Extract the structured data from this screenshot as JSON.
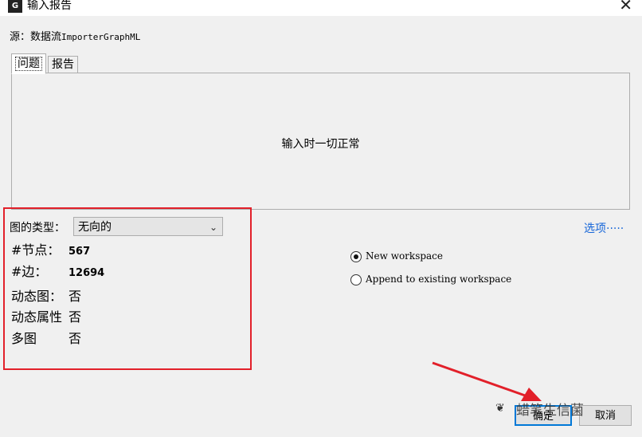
{
  "window": {
    "title": "输入报告",
    "app_icon": "gephi-app-icon",
    "close_label": "✕"
  },
  "source": {
    "label": "源：",
    "value_prefix": "数据流",
    "value_name": "ImporterGraphML"
  },
  "tabs": [
    {
      "label": "问题"
    },
    {
      "label": "报告"
    }
  ],
  "panel": {
    "message": "输入时一切正常"
  },
  "graph_type": {
    "label": "图的类型：",
    "selected": "无向的"
  },
  "stats": [
    {
      "key": "#节点：",
      "value": "567"
    },
    {
      "key": "#边：",
      "value": "12694"
    },
    {
      "key": "动态图：",
      "value": "否"
    },
    {
      "key": "动态属性",
      "value": "否"
    },
    {
      "key": "多图",
      "value": "否"
    }
  ],
  "options_link": "选项·····",
  "workspace": {
    "new_label": "New workspace",
    "append_label": "Append to existing workspace",
    "selected": "new"
  },
  "buttons": {
    "ok": "确定",
    "cancel": "取消"
  },
  "watermark": "蜡笔生信菌",
  "colors": {
    "highlight_box": "#e2202a",
    "arrow": "#e2202a",
    "link": "#1565d8"
  }
}
